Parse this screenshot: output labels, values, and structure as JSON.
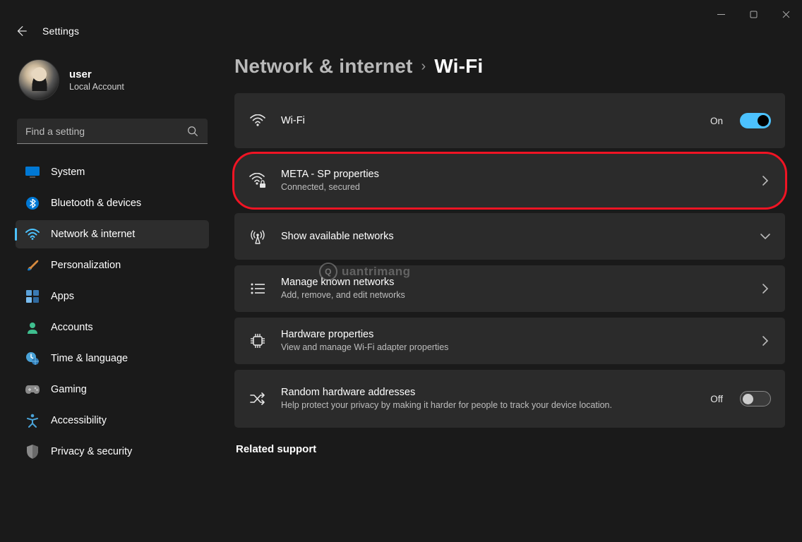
{
  "window": {
    "title": "Settings"
  },
  "profile": {
    "name": "user",
    "subtitle": "Local Account"
  },
  "search": {
    "placeholder": "Find a setting"
  },
  "nav": {
    "items": [
      {
        "label": "System"
      },
      {
        "label": "Bluetooth & devices"
      },
      {
        "label": "Network & internet"
      },
      {
        "label": "Personalization"
      },
      {
        "label": "Apps"
      },
      {
        "label": "Accounts"
      },
      {
        "label": "Time & language"
      },
      {
        "label": "Gaming"
      },
      {
        "label": "Accessibility"
      },
      {
        "label": "Privacy & security"
      }
    ],
    "selected_index": 2
  },
  "breadcrumb": {
    "parent": "Network & internet",
    "current": "Wi-Fi"
  },
  "wifi_toggle": {
    "label": "Wi-Fi",
    "state_text": "On",
    "on": true
  },
  "connected_network": {
    "title": "META - SP properties",
    "subtitle": "Connected, secured"
  },
  "available_networks": {
    "title": "Show available networks"
  },
  "known_networks": {
    "title": "Manage known networks",
    "subtitle": "Add, remove, and edit networks"
  },
  "hardware": {
    "title": "Hardware properties",
    "subtitle": "View and manage Wi-Fi adapter properties"
  },
  "random_mac": {
    "title": "Random hardware addresses",
    "subtitle": "Help protect your privacy by making it harder for people to track your device location.",
    "state_text": "Off",
    "on": false
  },
  "related_support": {
    "heading": "Related support"
  },
  "watermark": {
    "text": "uantrimang",
    "letter": "Q"
  }
}
